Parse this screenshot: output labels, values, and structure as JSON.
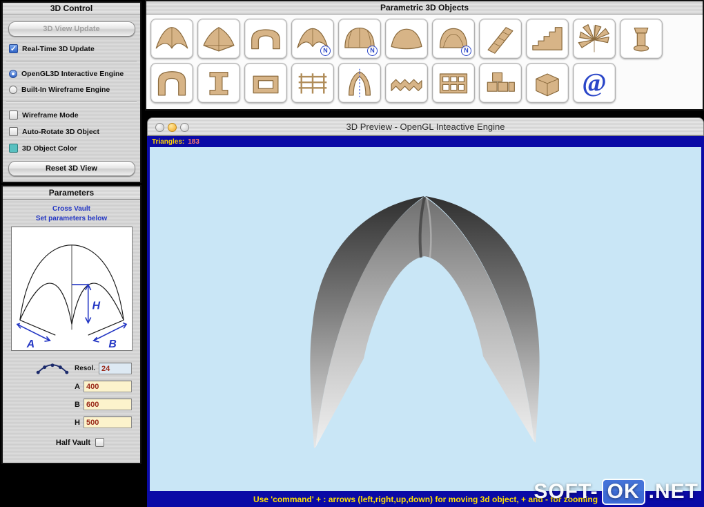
{
  "control_panel": {
    "title": "3D Control",
    "update_button": "3D View Update",
    "realtime_checkbox": "Real-Time 3D Update",
    "engine_radio_opengl": "OpenGL3D Interactive Engine",
    "engine_radio_wireframe": "Built-In Wireframe Engine",
    "wireframe_checkbox": "Wireframe Mode",
    "autorotate_checkbox": "Auto-Rotate 3D Object",
    "objectcolor_checkbox": "3D Object Color",
    "reset_button": "Reset 3D View"
  },
  "parameters_panel": {
    "title": "Parameters",
    "subtitle_line1": "Cross Vault",
    "subtitle_line2": "Set parameters below",
    "diagram": {
      "a": "A",
      "b": "B",
      "h": "H"
    },
    "resol": {
      "label": "Resol.",
      "value": "24"
    },
    "a": {
      "label": "A",
      "value": "400"
    },
    "b": {
      "label": "B",
      "value": "600"
    },
    "h": {
      "label": "H",
      "value": "500"
    },
    "half_vault_label": "Half Vault"
  },
  "palette": {
    "title": "Parametric 3D Objects",
    "rows": [
      [
        {
          "icon": "cross-vault"
        },
        {
          "icon": "pavilion-vault"
        },
        {
          "icon": "barrel-vault"
        },
        {
          "icon": "cross-vault-rounded",
          "badge": "N"
        },
        {
          "icon": "cloister-vault",
          "badge": "N"
        },
        {
          "icon": "sail-vault"
        },
        {
          "icon": "dome",
          "badge": "N"
        },
        {
          "icon": "truss"
        },
        {
          "icon": "stairs"
        },
        {
          "icon": "spiral-stairs"
        },
        {
          "icon": "column"
        }
      ],
      [
        {
          "icon": "arch-portal"
        },
        {
          "icon": "i-beam"
        },
        {
          "icon": "box-profile"
        },
        {
          "icon": "railing"
        },
        {
          "icon": "pointed-arch"
        },
        {
          "icon": "zigzag-stairs"
        },
        {
          "icon": "waffle-slab"
        },
        {
          "icon": "block-assembly"
        },
        {
          "icon": "cube"
        },
        {
          "icon": "at-symbol",
          "glyph": "@"
        }
      ]
    ]
  },
  "preview": {
    "title": "3D Preview - OpenGL Inteactive Engine",
    "triangles_label": "Triangles:",
    "triangles_value": "183",
    "footer": "Use 'command' + : arrows (left,right,up,down) for moving 3d object, + and - for zooming"
  },
  "watermark": {
    "part1": "SOFT-",
    "part2": "OK",
    "part3": ".NET"
  }
}
